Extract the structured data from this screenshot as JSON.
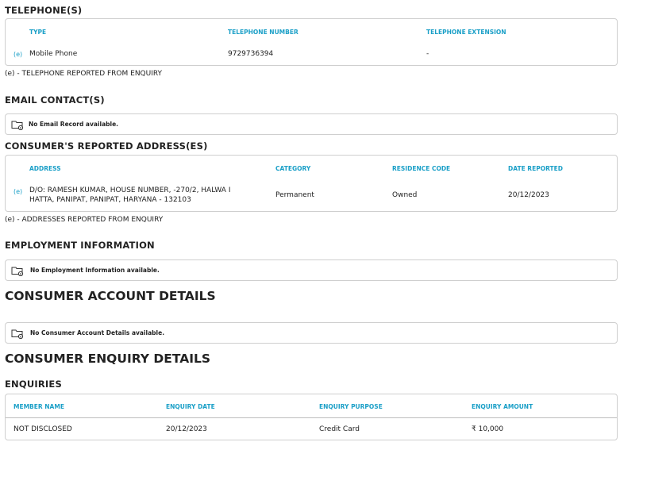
{
  "telephones": {
    "title": "TELEPHONE(S)",
    "headers": [
      "TYPE",
      "TELEPHONE NUMBER",
      "TELEPHONE EXTENSION"
    ],
    "rows": [
      {
        "marker": "(e)",
        "type": "Mobile Phone",
        "number": "9729736394",
        "extension": "-"
      }
    ],
    "footnote": "(e) - TELEPHONE REPORTED FROM ENQUIRY"
  },
  "email": {
    "title": "EMAIL CONTACT(S)",
    "empty": "No Email Record available.",
    "icon": "folder-info-icon"
  },
  "addresses": {
    "title": "CONSUMER'S REPORTED ADDRESS(ES)",
    "headers": [
      "ADDRESS",
      "CATEGORY",
      "RESIDENCE CODE",
      "DATE REPORTED"
    ],
    "rows": [
      {
        "marker": "(e)",
        "address_line1": "D/O: RAMESH KUMAR, HOUSE NUMBER, -270/2, HALWA I",
        "address_line2": "HATTA, PANIPAT, PANIPAT, HARYANA - 132103",
        "category": "Permanent",
        "residence_code": "Owned",
        "date_reported": "20/12/2023"
      }
    ],
    "footnote": "(e) - ADDRESSES REPORTED FROM ENQUIRY"
  },
  "employment": {
    "title": "EMPLOYMENT INFORMATION",
    "empty": "No Employment Information available."
  },
  "accounts": {
    "title": "CONSUMER ACCOUNT DETAILS",
    "empty": "No Consumer Account Details available."
  },
  "enquiry_details": {
    "title": "CONSUMER ENQUIRY DETAILS",
    "subtitle": "ENQUIRIES",
    "headers": [
      "MEMBER NAME",
      "ENQUIRY DATE",
      "ENQUIRY PURPOSE",
      "ENQUIRY AMOUNT"
    ],
    "rows": [
      {
        "member": "NOT DISCLOSED",
        "date": "20/12/2023",
        "purpose": "Credit Card",
        "amount": "₹ 10,000"
      }
    ]
  },
  "colors": {
    "accent": "#1a9fc7",
    "border": "#cfcfcf"
  }
}
